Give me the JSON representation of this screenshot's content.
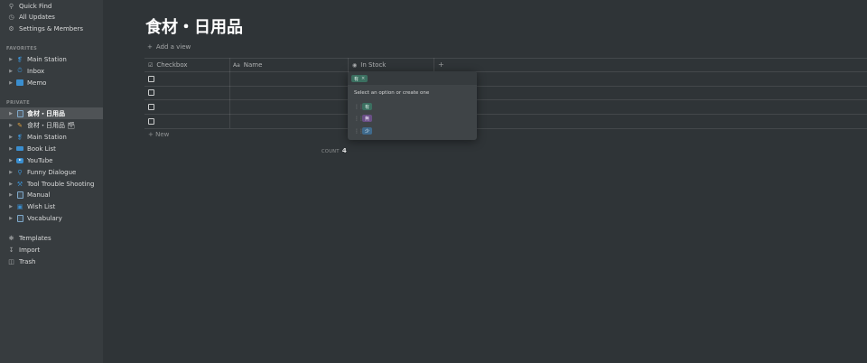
{
  "sidebar": {
    "top_items": [
      {
        "label": "Quick Find",
        "icon": "search-icon"
      },
      {
        "label": "All Updates",
        "icon": "clock-icon"
      },
      {
        "label": "Settings & Members",
        "icon": "gear-icon"
      }
    ],
    "favorites_header": "FAVORITES",
    "favorites": [
      {
        "label": "Main Station",
        "icon": "satellite-icon"
      },
      {
        "label": "Inbox",
        "icon": "stopwatch-icon"
      },
      {
        "label": "Memo",
        "icon": "notebook-icon"
      }
    ],
    "private_header": "PRIVATE",
    "private": [
      {
        "label": "食材・日用品",
        "icon": "page-icon",
        "active": true
      },
      {
        "label": "食材・日用品 🗃",
        "icon": "pencil-icon"
      },
      {
        "label": "Main Station",
        "icon": "satellite-icon"
      },
      {
        "label": "Book List",
        "icon": "books-icon"
      },
      {
        "label": "YouTube",
        "icon": "youtube-icon"
      },
      {
        "label": "Funny Dialogue",
        "icon": "bulb-icon"
      },
      {
        "label": "Tool Trouble Shooting",
        "icon": "tools-icon"
      },
      {
        "label": "Manual",
        "icon": "notebook-icon"
      },
      {
        "label": "Wish List",
        "icon": "gift-icon"
      },
      {
        "label": "Vocabulary",
        "icon": "notebook-icon"
      }
    ],
    "bottom_items": [
      {
        "label": "Templates",
        "icon": "templates-icon"
      },
      {
        "label": "Import",
        "icon": "import-icon"
      },
      {
        "label": "Trash",
        "icon": "trash-icon"
      }
    ]
  },
  "main": {
    "title": "食材・日用品",
    "add_view": "Add a view",
    "columns": [
      {
        "label": "Checkbox",
        "icon": "checkbox-icon"
      },
      {
        "label": "Name",
        "icon": "text-icon"
      },
      {
        "label": "In Stock",
        "icon": "select-icon"
      }
    ],
    "add_column": "+",
    "row_count_visible": 4,
    "new_row": "New",
    "count_label": "COUNT",
    "count_value": "4"
  },
  "dropdown": {
    "selected": "有",
    "remove_glyph": "×",
    "hint": "Select an option or create one",
    "options": [
      {
        "label": "有",
        "bg": "#3b6f60",
        "fg": "#e6f5ef"
      },
      {
        "label": "無",
        "bg": "#6a4f86",
        "fg": "#f0e6fa"
      },
      {
        "label": "少",
        "bg": "#3f6a8c",
        "fg": "#e4f0fa"
      }
    ]
  },
  "colors": {
    "background": "#2f3437",
    "sidebar": "#373c3f",
    "dropdown": "#3f4447"
  }
}
